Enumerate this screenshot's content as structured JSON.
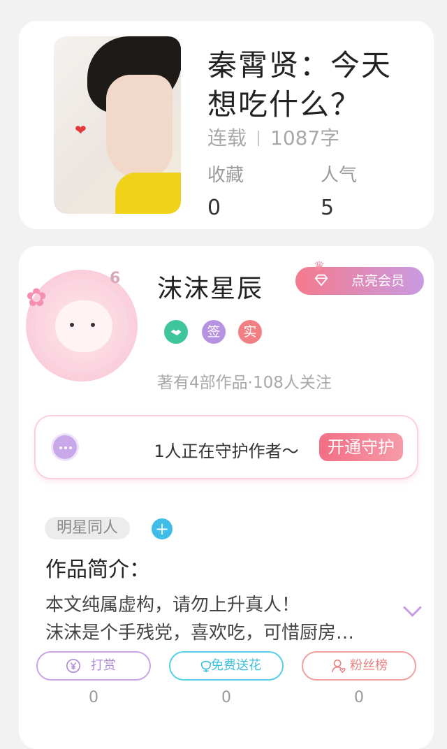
{
  "book": {
    "title": "秦霄贤：今天想吃什么？",
    "status": "连载",
    "word_count": "1087字",
    "favorites_label": "收藏",
    "favorites_value": "0",
    "popularity_label": "人气",
    "popularity_value": "5"
  },
  "author": {
    "name": "沫沫星辰",
    "level": "6",
    "vip_button": "点亮会员",
    "badges": [
      "签",
      "实"
    ],
    "info": "著有4部作品·108人关注"
  },
  "guard": {
    "text": "1人正在守护作者～",
    "button": "开通守护"
  },
  "tags": {
    "items": [
      "明星同人"
    ],
    "add_symbol": "+"
  },
  "intro": {
    "title": "作品简介：",
    "line1": "本文纯属虚构，请勿上升真人！",
    "line2": "沫沫是个手残党，喜欢吃，可惜厨房…"
  },
  "actions": [
    {
      "label": "打赏",
      "count": "0",
      "icon": "yen-circle-icon"
    },
    {
      "label": "免费送花",
      "count": "0",
      "icon": "flower-icon"
    },
    {
      "label": "粉丝榜",
      "count": "0",
      "icon": "user-heart-icon"
    }
  ],
  "colors": {
    "vip_gradient_start": "#f47a8c",
    "vip_gradient_end": "#c99be2",
    "guard_button": "#f26e84",
    "tag_add": "#3dbde7"
  }
}
